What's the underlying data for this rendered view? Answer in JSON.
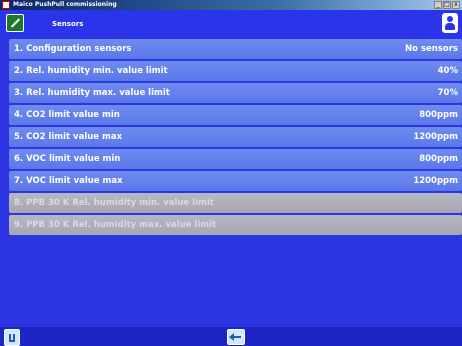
{
  "window": {
    "title": "Maico PushPull commissioning",
    "buttons": {
      "minimize": "_",
      "maximize": "□",
      "close": "x"
    }
  },
  "header": {
    "title": "Sensors",
    "left_icon": "home-icon",
    "right_icon": "user-icon"
  },
  "items": [
    {
      "label": "1. Configuration sensors",
      "value": "No sensors",
      "enabled": true
    },
    {
      "label": "2. Rel. humidity min. value limit",
      "value": "40%",
      "enabled": true
    },
    {
      "label": "3. Rel. humidity max. value limit",
      "value": "70%",
      "enabled": true
    },
    {
      "label": "4. CO2 limit value min",
      "value": "800ppm",
      "enabled": true
    },
    {
      "label": "5. CO2 limit value max",
      "value": "1200ppm",
      "enabled": true
    },
    {
      "label": "6. VOC limit value min",
      "value": "800ppm",
      "enabled": true
    },
    {
      "label": "7. VOC limit value max",
      "value": "1200ppm",
      "enabled": true
    },
    {
      "label": "8. PPB 30 K Rel. humidity min. value limit",
      "value": "",
      "enabled": false
    },
    {
      "label": "9. PPB 30 K Rel. humidity max. value limit",
      "value": "",
      "enabled": false
    }
  ],
  "footer": {
    "left_icon": "save-icon",
    "center_icon": "back-arrow-icon"
  },
  "colors": {
    "background": "#2d35e3",
    "row": "#6480ec",
    "row_disabled": "#b0b0bc",
    "footer": "#1d24c4"
  }
}
